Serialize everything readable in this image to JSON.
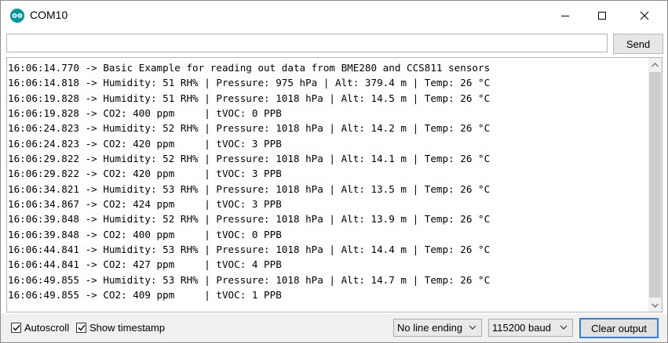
{
  "window": {
    "title": "COM10"
  },
  "send": {
    "input_value": "",
    "button_label": "Send"
  },
  "output": {
    "lines": [
      "16:06:14.770 -> Basic Example for reading out data from BME280 and CCS811 sensors",
      "16:06:14.818 -> Humidity: 51 RH% | Pressure: 975 hPa | Alt: 379.4 m | Temp: 26 °C",
      "16:06:19.828 -> Humidity: 51 RH% | Pressure: 1018 hPa | Alt: 14.5 m | Temp: 26 °C",
      "16:06:19.828 -> CO2: 400 ppm     | tVOC: 0 PPB",
      "16:06:24.823 -> Humidity: 52 RH% | Pressure: 1018 hPa | Alt: 14.2 m | Temp: 26 °C",
      "16:06:24.823 -> CO2: 420 ppm     | tVOC: 3 PPB",
      "16:06:29.822 -> Humidity: 52 RH% | Pressure: 1018 hPa | Alt: 14.1 m | Temp: 26 °C",
      "16:06:29.822 -> CO2: 420 ppm     | tVOC: 3 PPB",
      "16:06:34.821 -> Humidity: 53 RH% | Pressure: 1018 hPa | Alt: 13.5 m | Temp: 26 °C",
      "16:06:34.867 -> CO2: 424 ppm     | tVOC: 3 PPB",
      "16:06:39.848 -> Humidity: 52 RH% | Pressure: 1018 hPa | Alt: 13.9 m | Temp: 26 °C",
      "16:06:39.848 -> CO2: 400 ppm     | tVOC: 0 PPB",
      "16:06:44.841 -> Humidity: 53 RH% | Pressure: 1018 hPa | Alt: 14.4 m | Temp: 26 °C",
      "16:06:44.841 -> CO2: 427 ppm     | tVOC: 4 PPB",
      "16:06:49.855 -> Humidity: 53 RH% | Pressure: 1018 hPa | Alt: 14.7 m | Temp: 26 °C",
      "16:06:49.855 -> CO2: 409 ppm     | tVOC: 1 PPB"
    ]
  },
  "footer": {
    "autoscroll": {
      "label": "Autoscroll",
      "checked": true
    },
    "show_timestamp": {
      "label": "Show timestamp",
      "checked": true
    },
    "line_ending": {
      "selected": "No line ending"
    },
    "baud": {
      "selected": "115200 baud"
    },
    "clear_label": "Clear output"
  },
  "colors": {
    "app_icon": "#00979c",
    "focus_border": "#3c7fd1"
  },
  "icons": [
    "arduino-logo-icon",
    "minimize-icon",
    "maximize-icon",
    "close-icon",
    "scroll-up-icon",
    "scroll-down-icon",
    "checkmark-icon",
    "chevron-down-icon"
  ]
}
